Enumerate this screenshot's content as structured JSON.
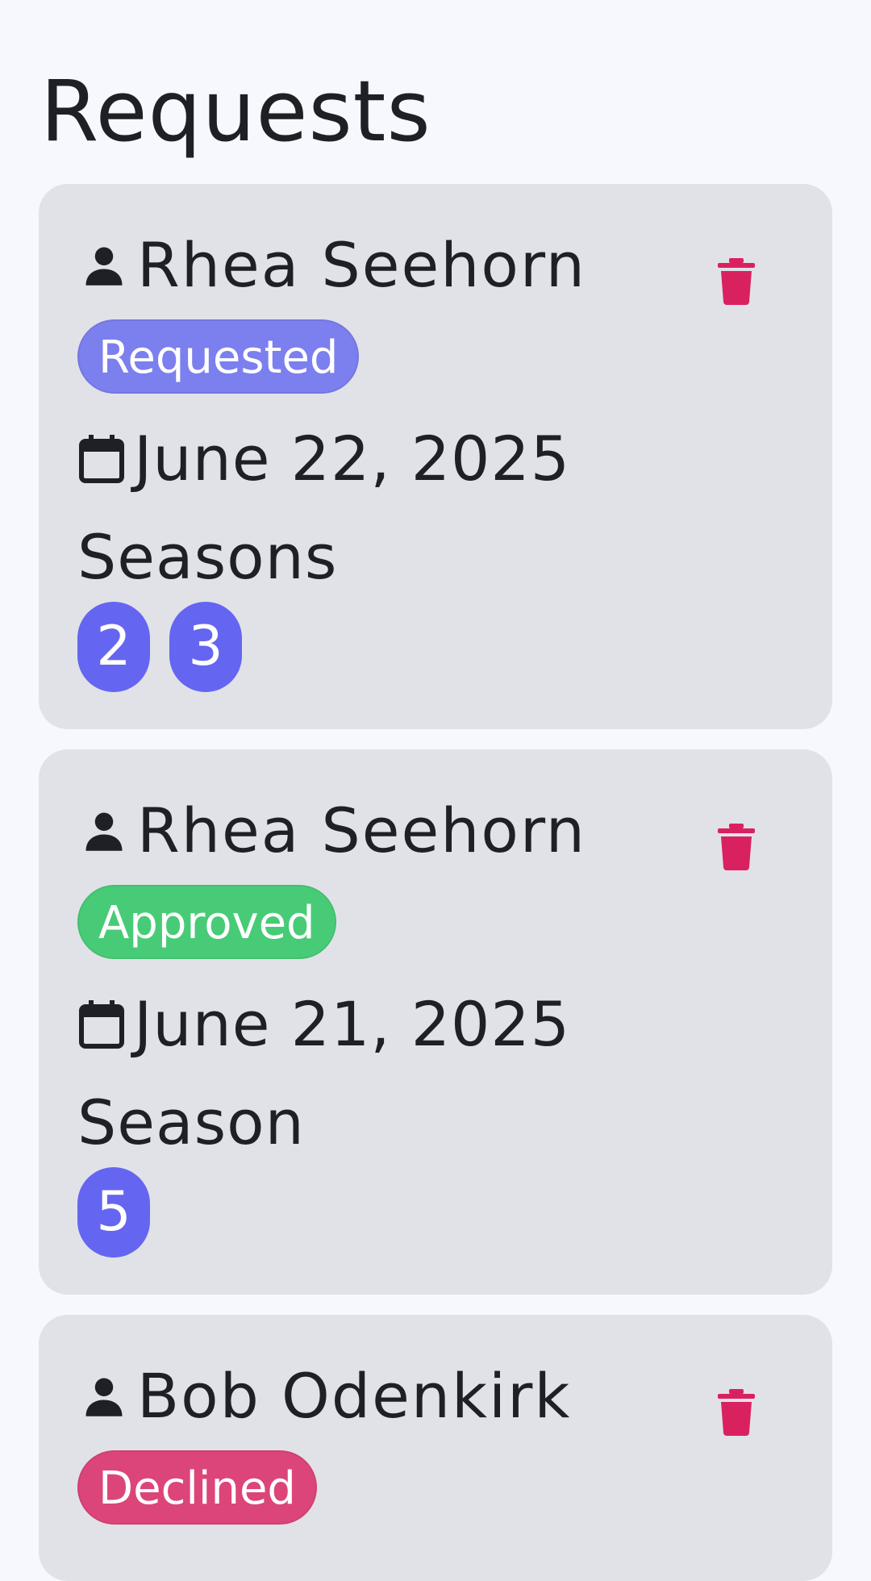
{
  "page": {
    "title": "Requests"
  },
  "colors": {
    "requested": "#7c7fee",
    "approved": "#48cb77",
    "declined": "#dc4579",
    "season_chip": "#6466f1",
    "trash": "#d92160"
  },
  "requests": [
    {
      "user": "Rhea Seehorn",
      "status": "Requested",
      "date": "June 22, 2025",
      "season_label": "Seasons",
      "seasons": [
        "2",
        "3"
      ]
    },
    {
      "user": "Rhea Seehorn",
      "status": "Approved",
      "date": "June 21, 2025",
      "season_label": "Season",
      "seasons": [
        "5"
      ]
    },
    {
      "user": "Bob Odenkirk",
      "status": "Declined"
    }
  ],
  "icons": {
    "person": "person-icon",
    "calendar": "calendar-icon",
    "delete": "trash-icon"
  }
}
